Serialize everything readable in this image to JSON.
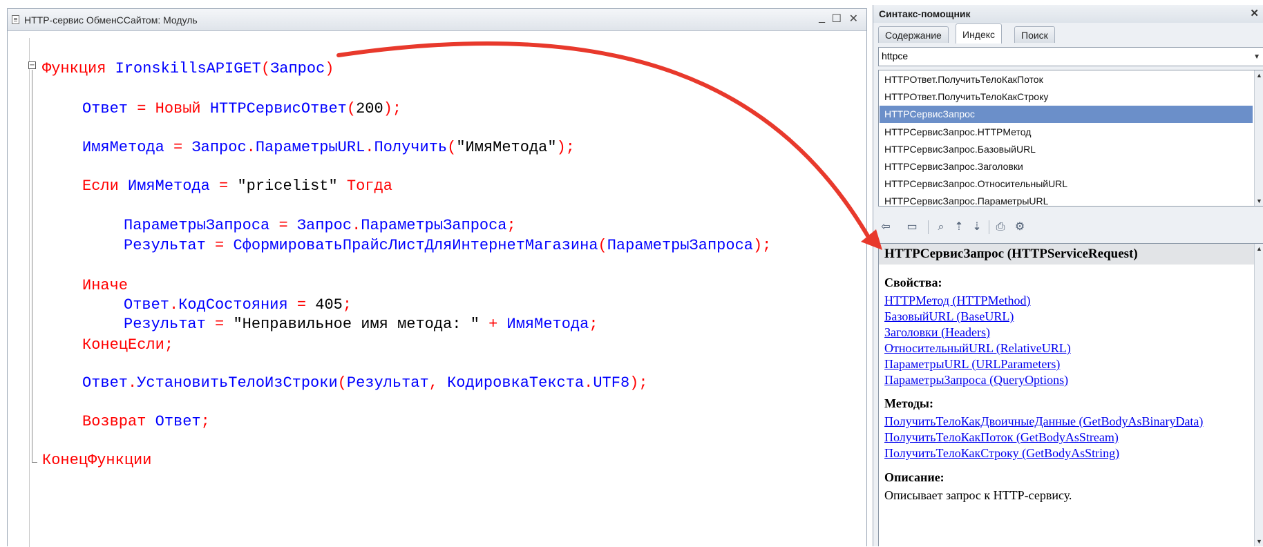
{
  "editor": {
    "title": "HTTP-сервис ОбменССайтом: Модуль",
    "controls": {
      "minimize": "_",
      "maximize": "☐",
      "close": "✕"
    },
    "fold_open": "−",
    "code": [
      [
        {
          "c": "kw",
          "t": "Функция "
        },
        {
          "c": "id",
          "t": "IronskillsAPIGET"
        },
        {
          "c": "kw",
          "t": "("
        },
        {
          "c": "id",
          "t": "Запрос"
        },
        {
          "c": "kw",
          "t": ")"
        }
      ],
      [
        {
          "c": "id",
          "t": "Ответ "
        },
        {
          "c": "kw",
          "t": "= "
        },
        {
          "c": "kw",
          "t": "Новый "
        },
        {
          "c": "id",
          "t": "HTTPСервисОтвет"
        },
        {
          "c": "kw",
          "t": "("
        },
        {
          "c": "lit",
          "t": "200"
        },
        {
          "c": "kw",
          "t": ");"
        }
      ],
      [
        {
          "c": "id",
          "t": "ИмяМетода "
        },
        {
          "c": "kw",
          "t": "= "
        },
        {
          "c": "id",
          "t": "Запрос"
        },
        {
          "c": "kw",
          "t": "."
        },
        {
          "c": "id",
          "t": "ПараметрыURL"
        },
        {
          "c": "kw",
          "t": "."
        },
        {
          "c": "id",
          "t": "Получить"
        },
        {
          "c": "kw",
          "t": "("
        },
        {
          "c": "lit",
          "t": "\"ИмяМетода\""
        },
        {
          "c": "kw",
          "t": ");"
        }
      ],
      [
        {
          "c": "kw",
          "t": "Если "
        },
        {
          "c": "id",
          "t": "ИмяМетода "
        },
        {
          "c": "kw",
          "t": "= "
        },
        {
          "c": "lit",
          "t": "\"pricelist\" "
        },
        {
          "c": "kw",
          "t": "Тогда"
        }
      ],
      [
        {
          "c": "id",
          "t": "ПараметрыЗапроса "
        },
        {
          "c": "kw",
          "t": "= "
        },
        {
          "c": "id",
          "t": "Запрос"
        },
        {
          "c": "kw",
          "t": "."
        },
        {
          "c": "id",
          "t": "ПараметрыЗапроса"
        },
        {
          "c": "kw",
          "t": ";"
        }
      ],
      [
        {
          "c": "id",
          "t": "Результат "
        },
        {
          "c": "kw",
          "t": "= "
        },
        {
          "c": "id",
          "t": "СформироватьПрайсЛистДляИнтернетМагазина"
        },
        {
          "c": "kw",
          "t": "("
        },
        {
          "c": "id",
          "t": "ПараметрыЗапроса"
        },
        {
          "c": "kw",
          "t": ");"
        }
      ],
      [
        {
          "c": "kw",
          "t": "Иначе"
        }
      ],
      [
        {
          "c": "id",
          "t": "Ответ"
        },
        {
          "c": "kw",
          "t": "."
        },
        {
          "c": "id",
          "t": "КодСостояния "
        },
        {
          "c": "kw",
          "t": "= "
        },
        {
          "c": "lit",
          "t": "405"
        },
        {
          "c": "kw",
          "t": ";"
        }
      ],
      [
        {
          "c": "id",
          "t": "Результат "
        },
        {
          "c": "kw",
          "t": "= "
        },
        {
          "c": "lit",
          "t": "\"Неправильное имя метода: \" "
        },
        {
          "c": "kw",
          "t": "+ "
        },
        {
          "c": "id",
          "t": "ИмяМетода"
        },
        {
          "c": "kw",
          "t": ";"
        }
      ],
      [
        {
          "c": "kw",
          "t": "КонецЕсли;"
        }
      ],
      [
        {
          "c": "id",
          "t": "Ответ"
        },
        {
          "c": "kw",
          "t": "."
        },
        {
          "c": "id",
          "t": "УстановитьТелоИзСтроки"
        },
        {
          "c": "kw",
          "t": "("
        },
        {
          "c": "id",
          "t": "Результат"
        },
        {
          "c": "kw",
          "t": ", "
        },
        {
          "c": "id",
          "t": "КодировкаТекста"
        },
        {
          "c": "kw",
          "t": "."
        },
        {
          "c": "id",
          "t": "UTF8"
        },
        {
          "c": "kw",
          "t": ");"
        }
      ],
      [
        {
          "c": "kw",
          "t": "Возврат "
        },
        {
          "c": "id",
          "t": "Ответ"
        },
        {
          "c": "kw",
          "t": ";"
        }
      ],
      [
        {
          "c": "kw",
          "t": "КонецФункции"
        }
      ]
    ]
  },
  "helper": {
    "title": "Синтакс-помощник",
    "close": "✕",
    "tabs": [
      "Содержание",
      "Индекс",
      "Поиск"
    ],
    "active_tab": "Индекс",
    "search_value": "httpce",
    "index_items": [
      "HTTPОтвет.ПолучитьТелоКакПоток",
      "HTTPОтвет.ПолучитьТелоКакСтроку",
      "HTTPСервисЗапрос",
      "HTTPСервисЗапрос.HTTPМетод",
      "HTTPСервисЗапрос.БазовыйURL",
      "HTTPСервисЗапрос.Заголовки",
      "HTTPСервисЗапрос.ОтносительныйURL",
      "HTTPСервисЗапрос.ПараметрыURL"
    ],
    "selected_index": 2,
    "toolbar_icons": [
      "back-icon",
      "forward-icon",
      "find-in-list-icon",
      "sync-up-icon",
      "sync-down-icon",
      "print-icon",
      "settings-icon"
    ],
    "help": {
      "header": "HTTPСервисЗапрос (HTTPServiceRequest)",
      "properties_title": "Свойства:",
      "properties": [
        "HTTPМетод (HTTPMethod)",
        "БазовыйURL (BaseURL)",
        "Заголовки (Headers)",
        "ОтносительныйURL (RelativeURL)",
        "ПараметрыURL (URLParameters)",
        "ПараметрыЗапроса (QueryOptions)"
      ],
      "methods_title": "Методы:",
      "methods": [
        "ПолучитьТелоКакДвоичныеДанные (GetBodyAsBinaryData)",
        "ПолучитьТелоКакПоток (GetBodyAsStream)",
        "ПолучитьТелоКакСтроку (GetBodyAsString)"
      ],
      "description_title": "Описание:",
      "description": "Описывает запрос к HTTP-сервису."
    }
  },
  "annotation": {
    "arrow_color": "#e8392c"
  }
}
